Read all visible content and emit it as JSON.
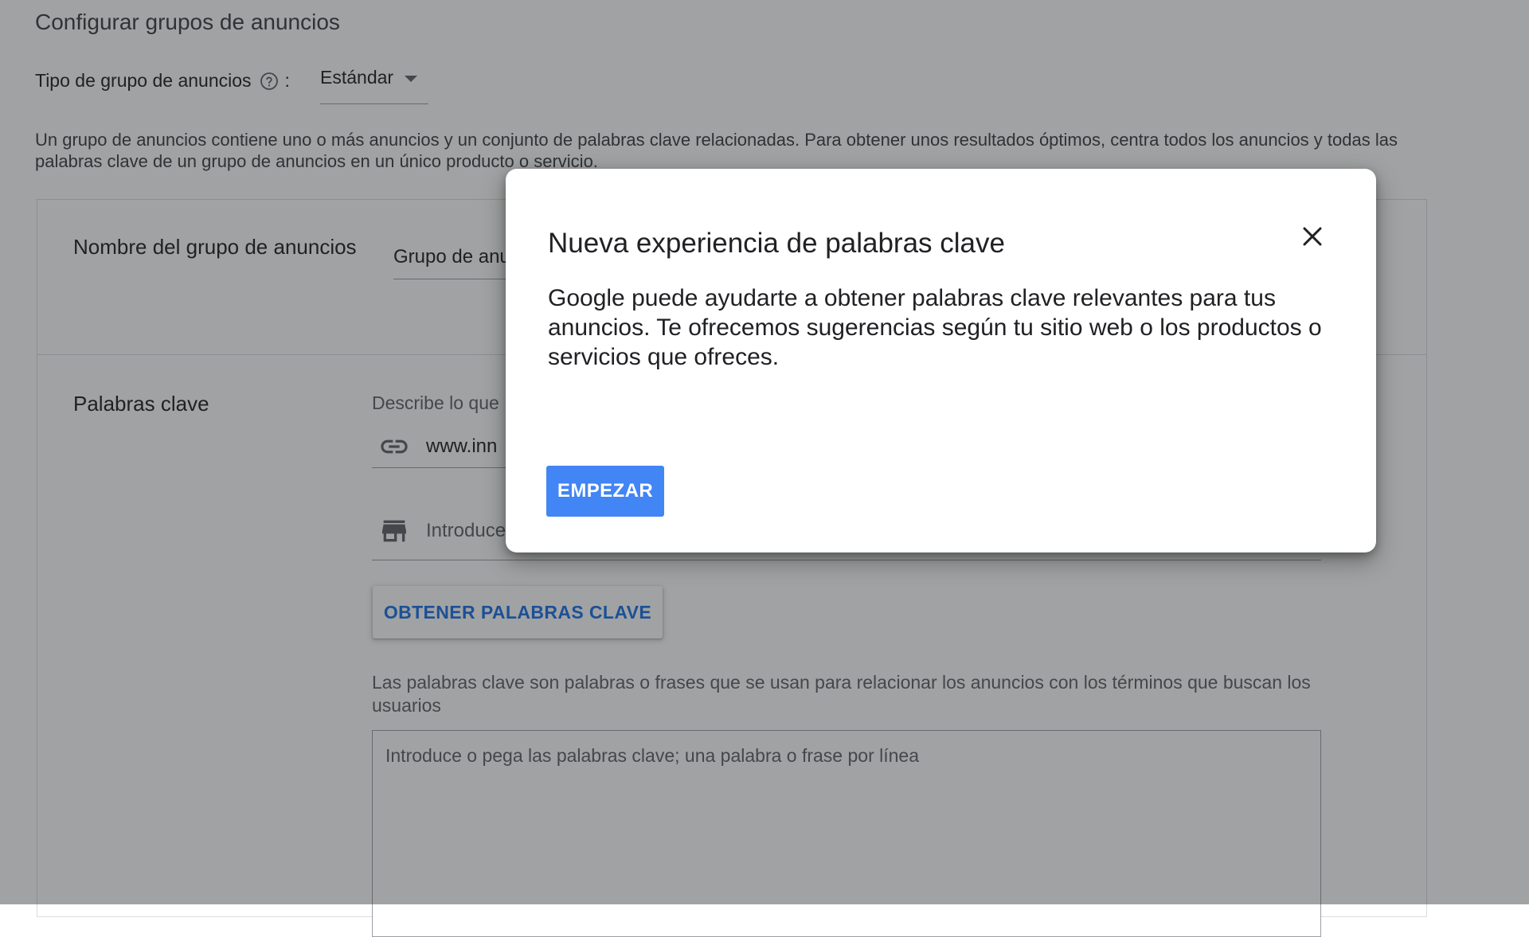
{
  "page": {
    "title": "Configurar grupos de anuncios",
    "ad_group_type": {
      "label": "Tipo de grupo de anuncios",
      "colon": ":",
      "value": "Estándar",
      "help_icon": "help-circle-icon"
    },
    "intro_text": "Un grupo de anuncios contiene uno o más anuncios y un conjunto de palabras clave relacionadas. Para obtener unos resultados óptimos, centra todos los anuncios y todas las palabras clave de un grupo de anuncios en un único producto o servicio."
  },
  "card": {
    "ad_group_name": {
      "label": "Nombre del grupo de anuncios",
      "value": "Grupo de anuncios 1"
    },
    "keywords": {
      "label": "Palabras clave",
      "describe_text": "Describe lo que",
      "url_field": {
        "icon": "link-icon",
        "value": "www.inn"
      },
      "product_field": {
        "icon": "store-icon",
        "placeholder": "Introduce"
      },
      "get_keywords_button": "OBTENER PALABRAS CLAVE",
      "help_text": "Las palabras clave son palabras o frases que se usan para relacionar los anuncios con los términos que buscan los usuarios",
      "textarea_placeholder": "Introduce o pega las palabras clave; una palabra o frase por línea"
    }
  },
  "dialog": {
    "title": "Nueva experiencia de palabras clave",
    "body": "Google puede ayudarte a obtener palabras clave relevantes para tus anuncios. Te ofrecemos sugerencias según tu sitio web o los productos o servicios que ofreces.",
    "close_icon": "close-icon",
    "start_button": "EMPEZAR"
  },
  "colors": {
    "primary_button": "#4285f4",
    "link_blue": "#1a73e8",
    "scrim": "rgba(32, 33, 36, 0.42)"
  }
}
